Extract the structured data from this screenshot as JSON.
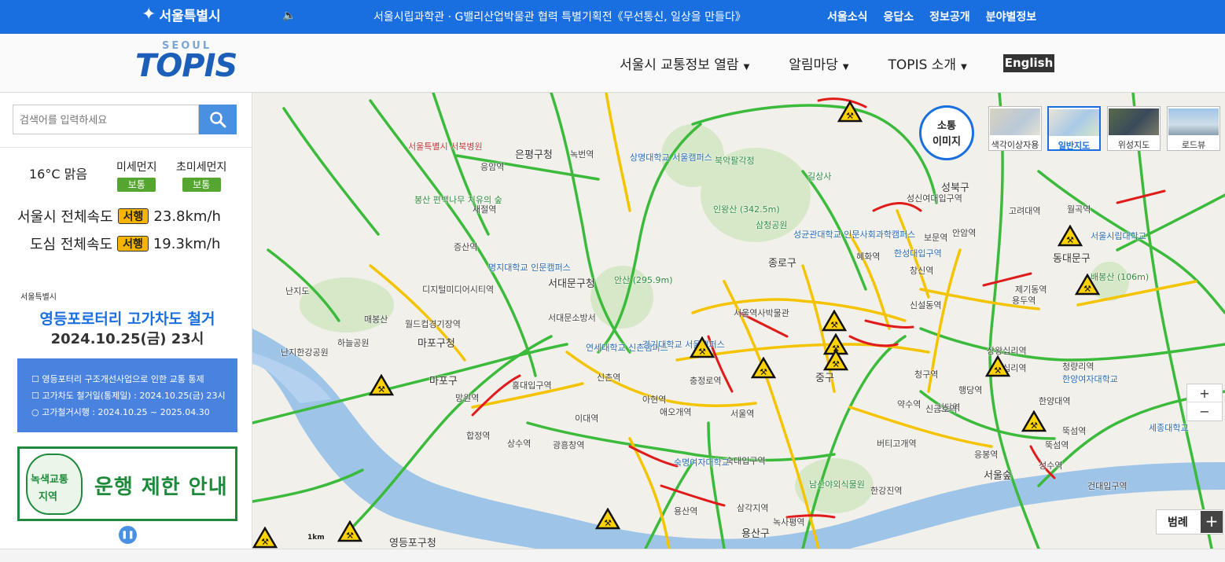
{
  "topbar": {
    "seoul_logo": "서울특별시",
    "ticker": "서울시립과학관 · G밸리산업박물관 협력 특별기획전《무선통신, 일상을 만들다》",
    "links": [
      "서울소식",
      "응답소",
      "정보공개",
      "분야별정보"
    ]
  },
  "header": {
    "logo_small": "SEOUL",
    "logo_main": "TOPIS",
    "nav": [
      "서울시 교통정보 열람",
      "알림마당",
      "TOPIS 소개"
    ],
    "english": "English"
  },
  "sidebar": {
    "search_placeholder": "검색어를 입력하세요",
    "weather": "16°C 맑음",
    "fine_dust_label": "미세먼지",
    "fine_dust_value": "보통",
    "ultra_dust_label": "초미세먼지",
    "ultra_dust_value": "보통",
    "city_speed_label": "서울시 전체속도",
    "city_speed_status": "서행",
    "city_speed_value": "23.8km/h",
    "downtown_speed_label": "도심 전체속도",
    "downtown_speed_status": "서행",
    "downtown_speed_value": "19.3km/h"
  },
  "banner1": {
    "logo": "서울특별시",
    "title": "영등포로터리 고가차도 철거",
    "date": "2024.10.25(금) 23시",
    "lines": [
      "☐ 영등포터리 구조개선사업으로 인한 교통 통제",
      "☐ 고가차도 철거일(통제일) : 2024.10.25(금) 23시",
      "○ 고가철거시행 : 2024.10.25 ~ 2025.04.30"
    ]
  },
  "banner2": {
    "line1": "녹색교통",
    "line2": "지역",
    "main": "운행 제한 안내"
  },
  "map": {
    "sotong_line1": "소통",
    "sotong_line2": "이미지",
    "map_types": [
      {
        "label": "색각이상자용",
        "active": false
      },
      {
        "label": "일반지도",
        "active": true
      },
      {
        "label": "위성지도",
        "active": false
      },
      {
        "label": "로드뷰",
        "active": false
      }
    ],
    "zoom_in": "+",
    "zoom_out": "−",
    "legend": "범례",
    "legend_plus": "+",
    "scale": "1km",
    "labels": [
      "은평구청",
      "서대문구청",
      "마포구청",
      "마포구",
      "종로구",
      "중구",
      "용산구",
      "성북구",
      "동대문구",
      "영등포구청",
      "서울역",
      "청구역",
      "약수역",
      "신당역",
      "서울숲",
      "뚝섬역",
      "안암역",
      "보문역",
      "혜화역",
      "한성대입구역",
      "창신역",
      "녹번역",
      "응암역",
      "증산역",
      "새절역",
      "디지털미디어시티역",
      "월드컵경기장역",
      "망원역",
      "합정역",
      "상수역",
      "광흥창역",
      "신촌역",
      "이대역",
      "아현역",
      "애오개역",
      "충정로역",
      "숙대입구역",
      "삼각지역",
      "녹사평역",
      "한강진역",
      "버티고개역",
      "신금호역",
      "행당역",
      "한양대역",
      "왕십리역",
      "성수역",
      "건대입구역",
      "뚝섬역",
      "응봉역",
      "상왕십리역",
      "신설동역",
      "제기동역",
      "용두역",
      "청량리역",
      "고려대역",
      "월곡역",
      "성신여대입구역",
      "길상사",
      "북악팔각정",
      "삼청공원",
      "안산 (295.9m)",
      "인왕산 (342.5m)",
      "배봉산 (106m)",
      "남산야외식물원",
      "난지도",
      "하늘공원",
      "난지한강공원",
      "매봉산",
      "상명대학교 서울캠퍼스",
      "명지대학교 인문캠퍼스",
      "연세대학교 신촌캠퍼스",
      "경기대학교 서울캠퍼스",
      "성균관대학교 인문사회과학캠퍼스",
      "숙명여자대학교",
      "서울시립대학교",
      "한양여자대학교",
      "세종대학교",
      "서울특별시 서북병원",
      "봉산 편백나무 치유의 숲",
      "서대문소방서",
      "홍대입구역",
      "용산역",
      "서울역사박물관"
    ]
  }
}
